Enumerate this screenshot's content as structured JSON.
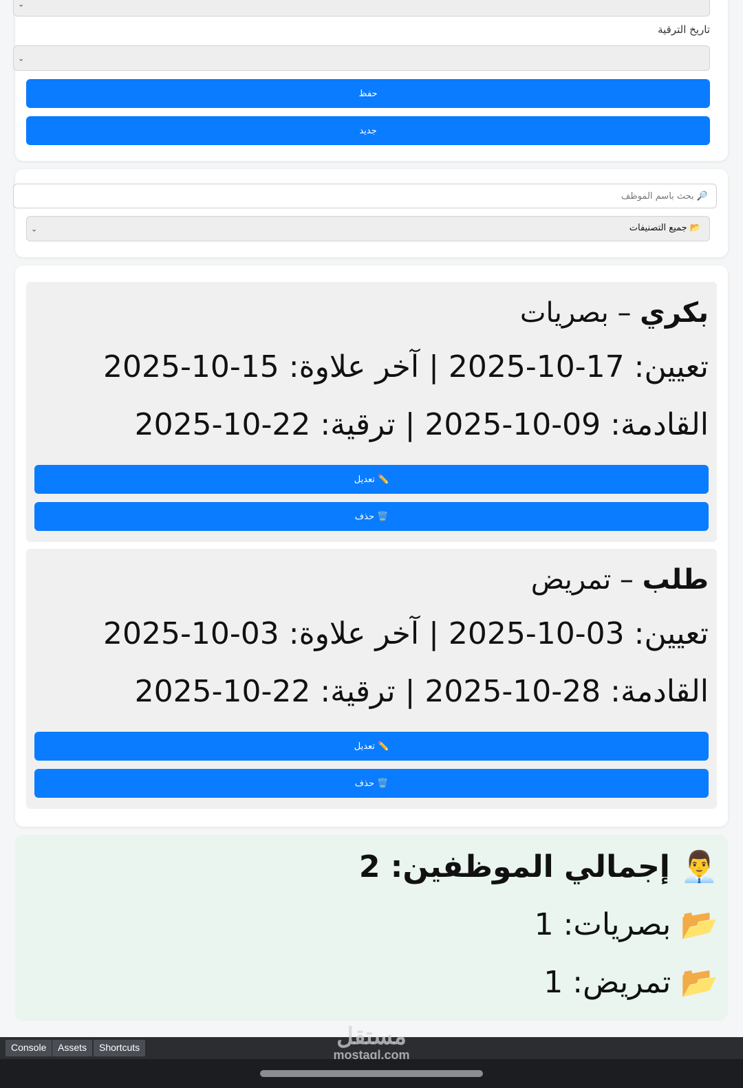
{
  "form": {
    "promotion_date_label": "تاريخ الترقية",
    "save_label": "حفظ",
    "new_label": "جديد"
  },
  "filters": {
    "search_placeholder": "🔎 بحث باسم الموظف",
    "category_select": "📂 جميع التصنيفات"
  },
  "employees": [
    {
      "name": "بكري",
      "dash": " – ",
      "category": "بصريات",
      "line1": "تعيين: 17-10-2025 | آخر علاوة: 15-10-2025",
      "line2": "القادمة: 09-10-2025 | ترقية: 22-10-2025",
      "edit_label": "✏️ تعديل",
      "delete_label": "🗑️ حذف"
    },
    {
      "name": "طلب",
      "dash": " – ",
      "category": "تمريض",
      "line1": "تعيين: 03-10-2025 | آخر علاوة: 03-10-2025",
      "line2": "القادمة: 28-10-2025 | ترقية: 22-10-2025",
      "edit_label": "✏️ تعديل",
      "delete_label": "🗑️ حذف"
    }
  ],
  "summary": {
    "total": "👨‍💼 إجمالي الموظفين: 2",
    "cat1": "📂 بصريات: 1",
    "cat2": "📂 تمريض: 1"
  },
  "devtools": {
    "console": "Console",
    "assets": "Assets",
    "shortcuts": "Shortcuts"
  },
  "watermark": {
    "arabic": "مستقل",
    "domain": "mostaql.com"
  },
  "colors": {
    "primary": "#0a7cff",
    "summary_bg": "#e9f5ee",
    "employee_card_bg": "#f0f0f0"
  }
}
